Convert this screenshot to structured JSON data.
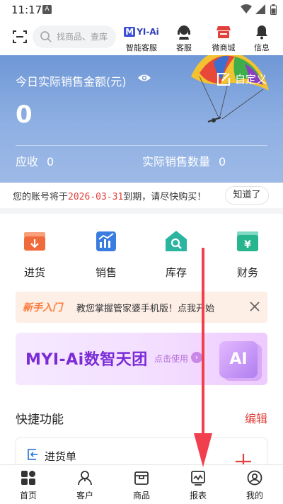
{
  "status_bar": {
    "time": "11:17",
    "notification_icon": "A"
  },
  "top_bar": {
    "search_placeholder": "找商品、查库",
    "items": [
      {
        "label": "智能客服",
        "logo_text": "YI-Ai",
        "logo_letter": "M",
        "icon": "myi-ai-logo"
      },
      {
        "label": "客服",
        "icon": "headset-icon"
      },
      {
        "label": "微商城",
        "icon": "store-icon"
      },
      {
        "label": "信息",
        "icon": "bell-icon"
      }
    ]
  },
  "sales_card": {
    "title": "今日实际销售金额(元)",
    "amount": "0",
    "customize_label": "自定义",
    "receivable_label": "应收",
    "receivable_value": "0",
    "quantity_label": "实际销售数量",
    "quantity_value": "0"
  },
  "notice": {
    "prefix": "您的账号将于",
    "date": "2026-03-31",
    "suffix": "到期，请尽快购买！",
    "button": "知道了"
  },
  "main_grid": [
    {
      "label": "进货",
      "icon": "purchase-icon",
      "color": "#f06a3c"
    },
    {
      "label": "销售",
      "icon": "sales-chart-icon",
      "color": "#3a7de0"
    },
    {
      "label": "库存",
      "icon": "warehouse-icon",
      "color": "#2bb5a0"
    },
    {
      "label": "财务",
      "icon": "finance-icon",
      "color": "#27b58e"
    }
  ],
  "beginner_banner": {
    "tag": "新手入门",
    "text": "教您掌握管家婆手机版！点我开始"
  },
  "ai_banner": {
    "brand": "YI-Ai数智天团",
    "brand_letter": "M",
    "action": "点击使用",
    "badge": "AI"
  },
  "quick_functions": {
    "title": "快捷功能",
    "edit": "编辑",
    "items": [
      {
        "label": "进货单"
      }
    ]
  },
  "tab_bar": [
    {
      "label": "首页",
      "icon": "home-grid-icon"
    },
    {
      "label": "客户",
      "icon": "customer-icon"
    },
    {
      "label": "商品",
      "icon": "goods-icon"
    },
    {
      "label": "报表",
      "icon": "report-icon"
    },
    {
      "label": "我的",
      "icon": "profile-icon"
    }
  ],
  "colors": {
    "accent_red": "#e0413c",
    "hero_blue": "#7a9fdc",
    "brand_purple": "#7a2bd6"
  }
}
